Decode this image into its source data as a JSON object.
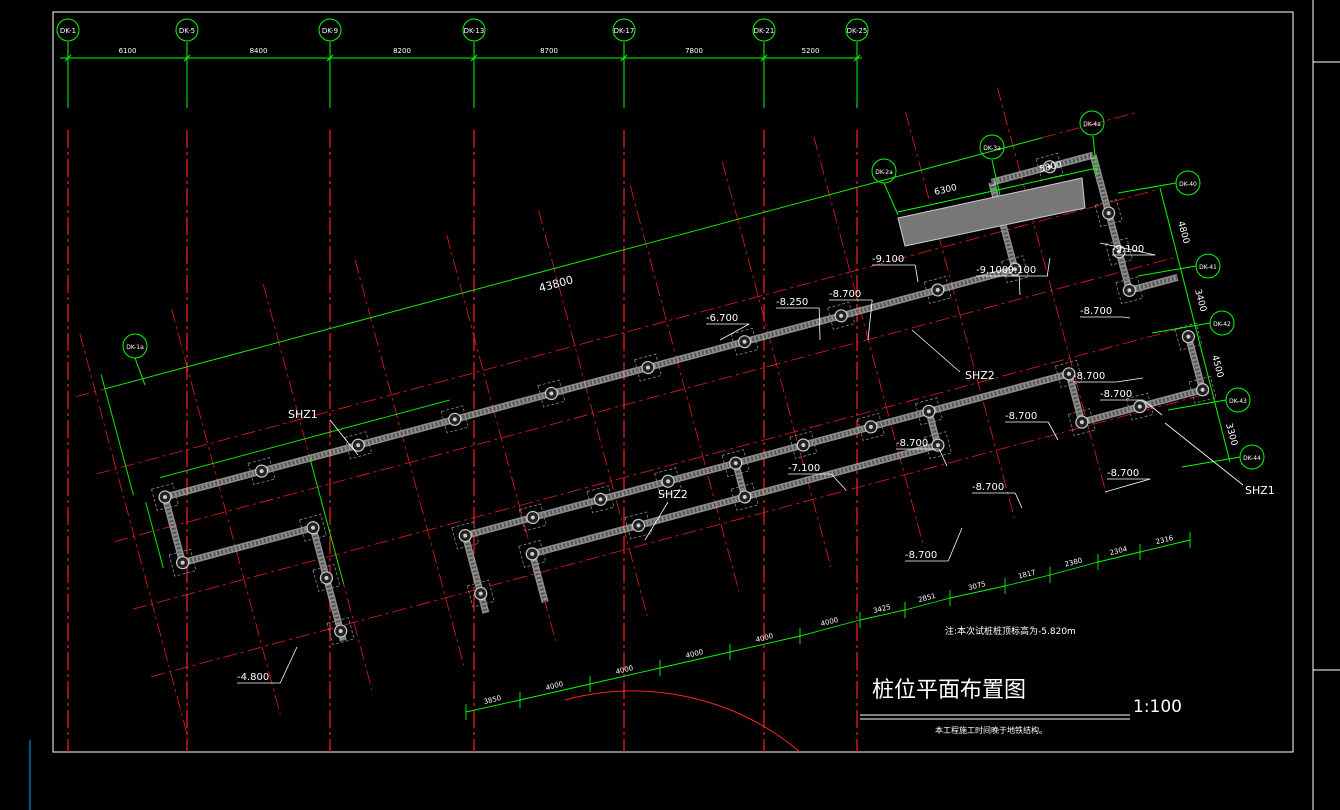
{
  "colors": {
    "background": "#000000",
    "frame": "#ffffff",
    "axis_line": "#ff2020",
    "dimension": "#00ff00",
    "text": "#ffffff",
    "pile": "#cccccc",
    "panel_line": "#00aaff"
  },
  "top_axes": {
    "labels": [
      "DK-1",
      "DK-5",
      "DK-9",
      "DK-13",
      "DK-17",
      "DK-21",
      "DK-25"
    ],
    "spacings": [
      "6100",
      "8400",
      "8200",
      "8700",
      "7800",
      "5200"
    ]
  },
  "rotated_axes": {
    "left": "DK-1a",
    "upper": [
      "DK-2a",
      "DK-3a",
      "DK-4a"
    ],
    "right": [
      "DK-40",
      "DK-41",
      "DK-42",
      "DK-43",
      "DK-44"
    ],
    "right_dims": [
      "4800",
      "3400",
      "4500",
      "3300"
    ],
    "upper_dims": [
      "6300",
      "5800"
    ]
  },
  "overall_dim": "43800",
  "wall_labels": [
    "SHZ1",
    "SHZ2",
    "SHZ2",
    "SHZ1"
  ],
  "elevations": [
    "-9.100",
    "-9.100",
    "-9.100",
    "-9.100",
    "-6.700",
    "-8.250",
    "-8.700",
    "-8.700",
    "-8.700",
    "-8.700",
    "-8.700",
    "-7.100",
    "-8.700",
    "-8.700",
    "-8.700",
    "-8.700",
    "-4.800"
  ],
  "bottom_dims": [
    "3850",
    "4000",
    "4000",
    "4000",
    "4000",
    "4000",
    "3425",
    "2851",
    "3075",
    "1817",
    "2380",
    "2304",
    "2316"
  ],
  "note_design": "注:本次试桩桩顶标高为-5.820m",
  "title": "桩位平面布置图",
  "scale": "1:100",
  "note_bottom": "本工程施工时间晚于地铁结构。"
}
